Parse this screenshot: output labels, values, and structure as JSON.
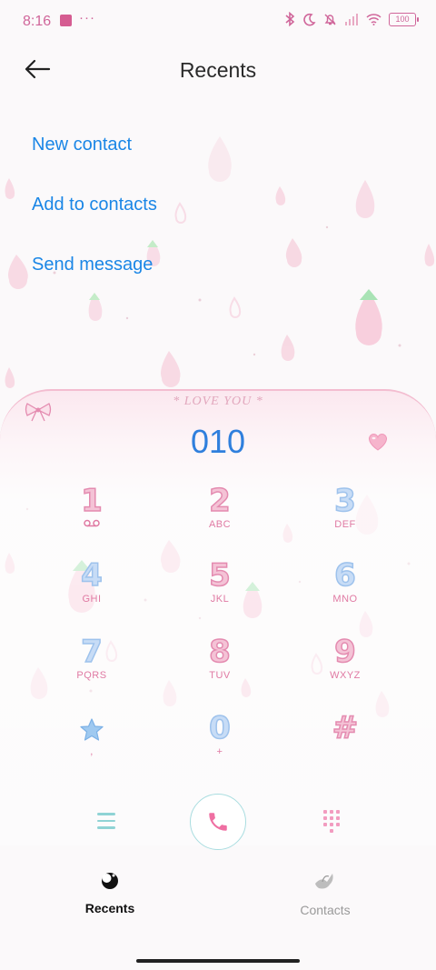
{
  "status_bar": {
    "time": "8:16",
    "dots": "···",
    "battery": "100",
    "icons": [
      "bluetooth-icon",
      "moon-icon",
      "bell-muted-icon",
      "signal-icon",
      "wifi-icon",
      "battery-icon"
    ]
  },
  "header": {
    "title": "Recents",
    "back_icon": "arrow-left-icon"
  },
  "actions": [
    {
      "label": "New contact"
    },
    {
      "label": "Add to contacts"
    },
    {
      "label": "Send message"
    }
  ],
  "dialer": {
    "banner": "* LOVE YOU *",
    "number": "010",
    "keys": [
      {
        "digit": "1",
        "letters": "voicemail-icon"
      },
      {
        "digit": "2",
        "letters": "ABC"
      },
      {
        "digit": "3",
        "letters": "DEF"
      },
      {
        "digit": "4",
        "letters": "GHI"
      },
      {
        "digit": "5",
        "letters": "JKL"
      },
      {
        "digit": "6",
        "letters": "MNO"
      },
      {
        "digit": "7",
        "letters": "PQRS"
      },
      {
        "digit": "8",
        "letters": "TUV"
      },
      {
        "digit": "9",
        "letters": "WXYZ"
      },
      {
        "digit": "*",
        "letters": ","
      },
      {
        "digit": "0",
        "letters": "+"
      },
      {
        "digit": "#",
        "letters": ""
      }
    ]
  },
  "nav": {
    "tabs": [
      {
        "label": "Recents",
        "active": true
      },
      {
        "label": "Contacts",
        "active": false
      }
    ]
  },
  "colors": {
    "accent_blue": "#1a86e6",
    "pink": "#e48bb0",
    "teal": "#8fd3d5"
  }
}
